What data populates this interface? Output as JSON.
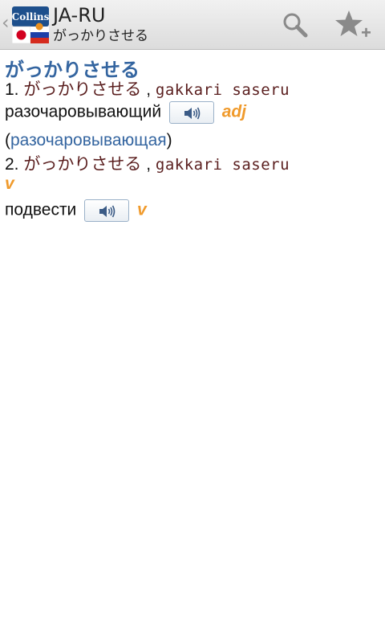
{
  "header": {
    "title": "JA-RU",
    "subtitle": "がっかりさせる",
    "logo_text": "Collins",
    "back_icon": "chevron-left-icon",
    "actions": [
      {
        "icon": "search-icon"
      },
      {
        "icon": "star-plus-icon"
      }
    ]
  },
  "entry": {
    "headword": "がっかりさせる",
    "senses": [
      {
        "number": "1.",
        "japanese": "がっかりさせる",
        "separator": ",",
        "romaji": "gakkari saseru",
        "translation": "разочаровывающий",
        "pos": "adj",
        "note_open": "(",
        "note": "разочаровывающая",
        "note_close": ")"
      },
      {
        "number": "2.",
        "japanese": "がっかりさせる",
        "separator": ",",
        "romaji": "gakkari saseru",
        "pos_label": "v",
        "translation": "подвести",
        "pos": "v"
      }
    ]
  },
  "colors": {
    "headword": "#3465a0",
    "japanese": "#5a1e1e",
    "pos": "#f09a2b",
    "link": "#3465a0",
    "actionbar": "#e6e6e6"
  }
}
